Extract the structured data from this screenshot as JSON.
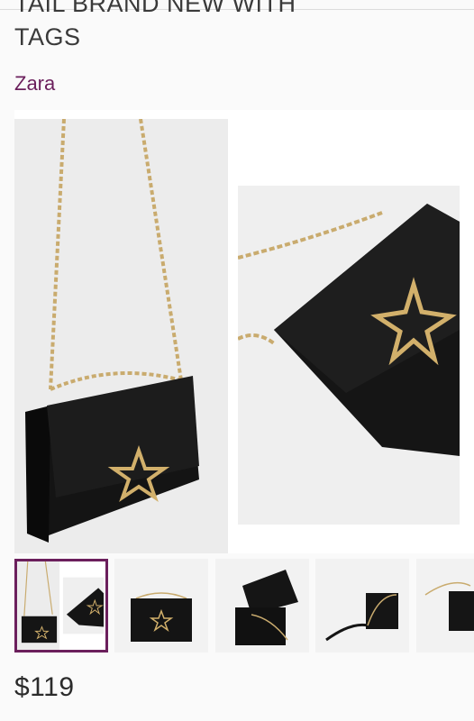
{
  "product": {
    "title_line1": "TAIL BRAND NEW WITH",
    "title_line2": "TAGS",
    "brand": "Zara",
    "price": "$119",
    "accent_color": "#6b1f5c"
  },
  "gallery": {
    "selected_thumbnail": 1,
    "thumbnail_count_visible": 5
  }
}
